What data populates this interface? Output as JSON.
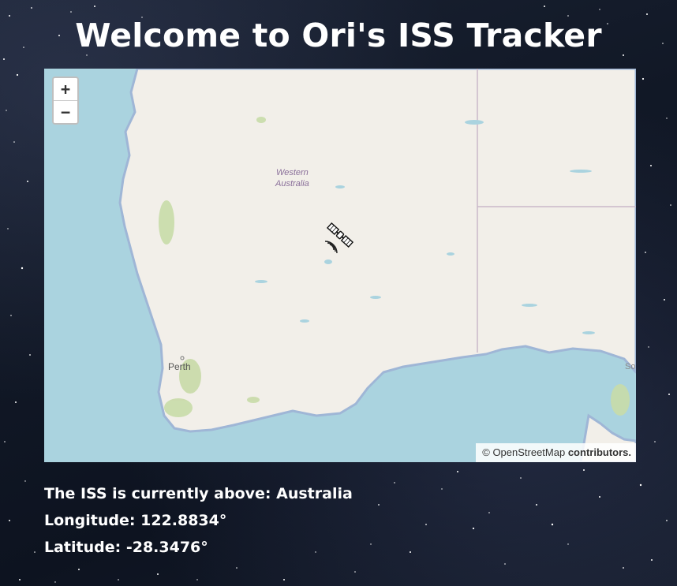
{
  "page": {
    "title": "Welcome to Ori's ISS Tracker"
  },
  "map": {
    "zoom_in_label": "+",
    "zoom_out_label": "−",
    "attribution": {
      "prefix": "© ",
      "link_text": "OpenStreetMap",
      "suffix": " contributors."
    },
    "labels": {
      "state_line1": "Western",
      "state_line2": "Australia",
      "city": "Perth",
      "edge_fragment": "So"
    },
    "colors": {
      "water": "#aad3df",
      "land": "#f2efe9",
      "parks": "#c8dba8",
      "boundary": "#c9b8c9",
      "coast": "#9fb6d6"
    }
  },
  "iss": {
    "country_label": "The ISS is currently above: ",
    "country": "Australia",
    "longitude_label": "Longitude: ",
    "longitude": "122.8834°",
    "latitude_label": "Latitude: ",
    "latitude": "-28.3476°"
  }
}
